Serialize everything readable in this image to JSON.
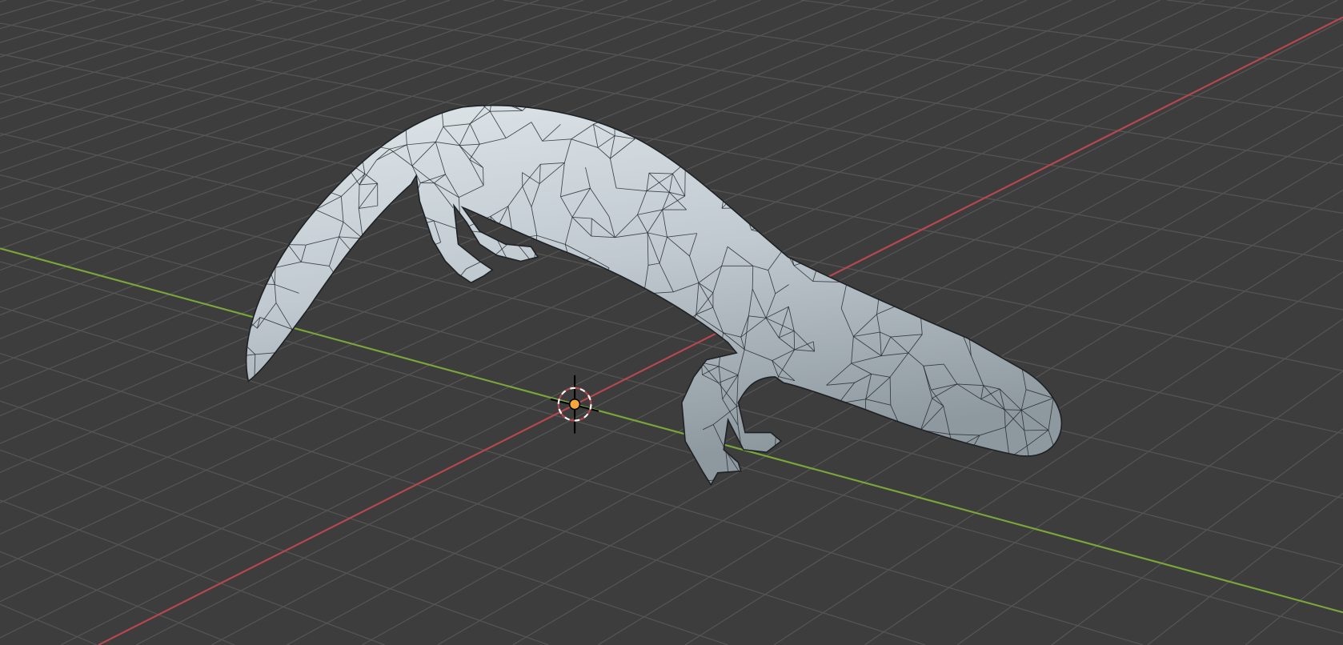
{
  "viewport": {
    "background_color": "#3d3d3d",
    "grid_color": "#545454",
    "x_axis_color": "#b8474f",
    "y_axis_color": "#7aa63a",
    "mesh_fill_color": "#c5ced3",
    "wire_color": "#1e2226",
    "cursor_center_color": "#f5a53c"
  },
  "object": {
    "icon": "lizard-mesh"
  },
  "cursor": {
    "icon": "3d-cursor-icon"
  }
}
